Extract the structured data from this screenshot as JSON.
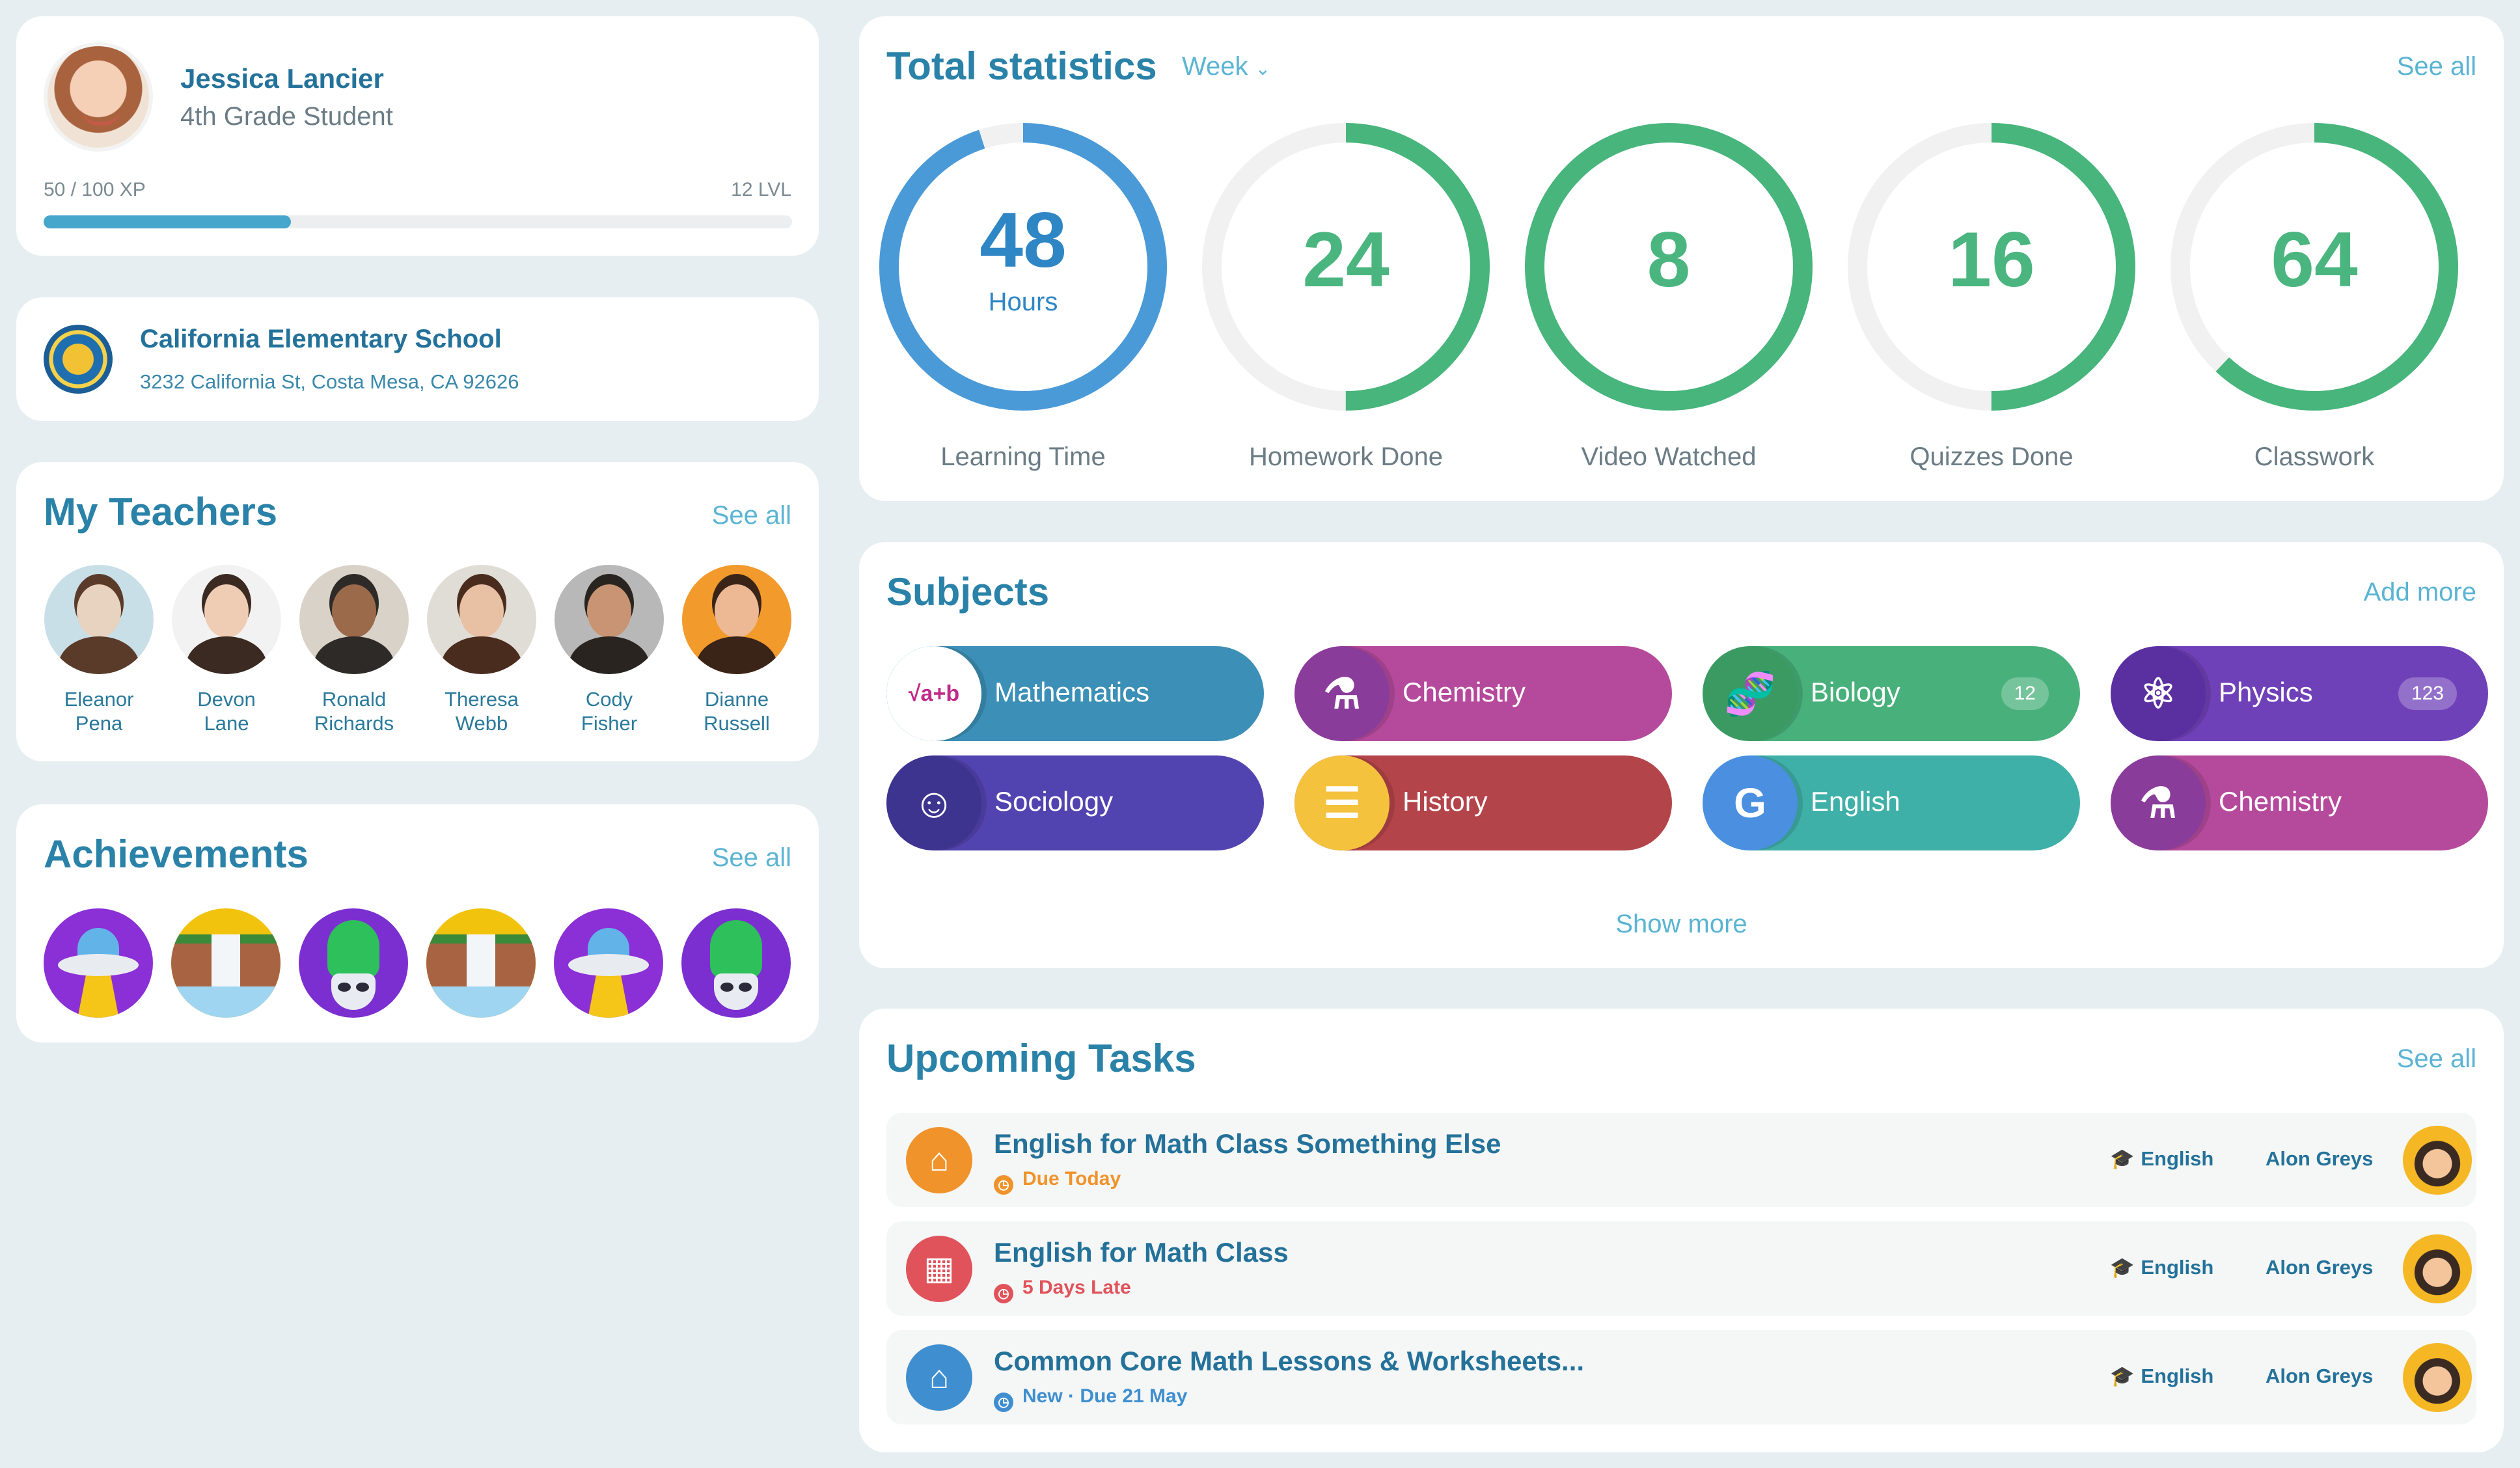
{
  "profile": {
    "name": "Jessica Lancier",
    "role": "4th Grade Student",
    "xp_text": "50 / 100 XP",
    "level_text": "12 LVL",
    "xp_progress": 0.33
  },
  "school": {
    "name": "California Elementary School",
    "address": "3232 California St, Costa Mesa, CA 92626"
  },
  "teachers": {
    "title": "My Teachers",
    "see_all": "See all",
    "items": [
      {
        "first": "Eleanor",
        "last": "Pena"
      },
      {
        "first": "Devon",
        "last": "Lane"
      },
      {
        "first": "Ronald",
        "last": "Richards"
      },
      {
        "first": "Theresa",
        "last": "Webb"
      },
      {
        "first": "Cody",
        "last": "Fisher"
      },
      {
        "first": "Dianne",
        "last": "Russell"
      }
    ]
  },
  "achievements": {
    "title": "Achievements",
    "see_all": "See all",
    "badges": [
      "ufo-badge-icon",
      "waterfall-badge-icon",
      "alien-badge-icon",
      "waterfall-badge-icon",
      "ufo-badge-icon",
      "alien-badge-icon"
    ]
  },
  "stats": {
    "title": "Total statistics",
    "period": "Week",
    "see_all": "See all",
    "items": [
      {
        "value": "48",
        "unit": "Hours",
        "label": "Learning Time",
        "progress": 0.95,
        "color": "#4a9ad8"
      },
      {
        "value": "24",
        "unit": "",
        "label": "Homework Done",
        "progress": 0.5,
        "color": "#47b57c"
      },
      {
        "value": "8",
        "unit": "",
        "label": "Video Watched",
        "progress": 1.0,
        "color": "#47b57c"
      },
      {
        "value": "16",
        "unit": "",
        "label": "Quizzes Done",
        "progress": 0.5,
        "color": "#47b57c"
      },
      {
        "value": "64",
        "unit": "",
        "label": "Classwork",
        "progress": 0.62,
        "color": "#47b57c"
      }
    ]
  },
  "subjects": {
    "title": "Subjects",
    "add_more": "Add more",
    "show_more": "Show more",
    "items": [
      {
        "label": "Mathematics",
        "count": "",
        "color": "#3c8fb6",
        "icon": "math-icon"
      },
      {
        "label": "Chemistry",
        "count": "",
        "color": "#b54a9c",
        "icon": "flask-icon"
      },
      {
        "label": "Biology",
        "count": "12",
        "color": "#48b07a",
        "icon": "dna-icon"
      },
      {
        "label": "Physics",
        "count": "123",
        "color": "#6f41b8",
        "icon": "atom-icon"
      },
      {
        "label": "Sociology",
        "count": "",
        "color": "#5244b0",
        "icon": "person-icon"
      },
      {
        "label": "History",
        "count": "",
        "color": "#b3444a",
        "icon": "scroll-icon"
      },
      {
        "label": "English",
        "count": "",
        "color": "#3fb0a8",
        "icon": "translate-icon"
      },
      {
        "label": "Chemistry",
        "count": "",
        "color": "#b54a9c",
        "icon": "flask-icon"
      }
    ]
  },
  "tasks": {
    "title": "Upcoming Tasks",
    "see_all": "See all",
    "items": [
      {
        "title": "English for Math Class Something Else",
        "due": "Due Today",
        "due_color": "#f0932b",
        "icon": "home-icon",
        "icon_bg": "#f0932b",
        "subject": "English",
        "teacher": "Alon Greys"
      },
      {
        "title": "English for Math Class",
        "due": "5 Days Late",
        "due_color": "#e0535a",
        "icon": "school-icon",
        "icon_bg": "#e0535a",
        "subject": "English",
        "teacher": "Alon Greys"
      },
      {
        "title": "Common Core Math Lessons & Worksheets...",
        "due": "New · Due 21 May",
        "due_color": "#3f8fd0",
        "icon": "home-icon",
        "icon_bg": "#3f8fd0",
        "subject": "English",
        "teacher": "Alon Greys"
      }
    ]
  }
}
